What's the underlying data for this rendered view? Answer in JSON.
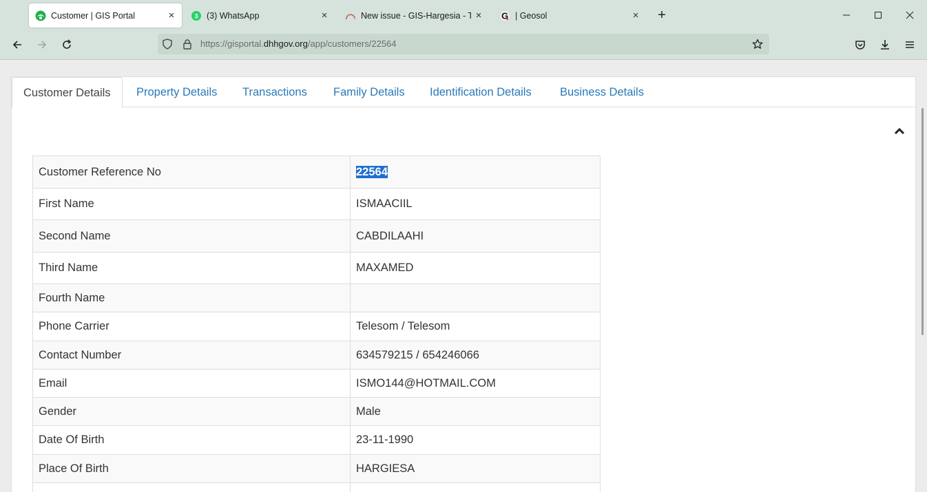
{
  "browser": {
    "tabs": [
      {
        "title": "Customer | GIS Portal",
        "icon": "gis-portal-icon",
        "close": "×"
      },
      {
        "title": "(3) WhatsApp",
        "icon": "whatsapp-icon",
        "badge": "3",
        "close": "×"
      },
      {
        "title": "New issue - GIS-Hargesia - Tean",
        "icon": "gitlab-icon",
        "close": "×"
      },
      {
        "title": "| Geosol",
        "icon": "geosol-icon",
        "badge": "G",
        "close": "×"
      }
    ],
    "new_tab": "+",
    "url": {
      "prefix": "https://gisportal.",
      "domain": "dhhgov.org",
      "path": "/app/customers/22564"
    }
  },
  "page": {
    "tabs": [
      {
        "label": "Customer Details",
        "active": true
      },
      {
        "label": "Property Details"
      },
      {
        "label": "Transactions"
      },
      {
        "label": "Family Details"
      },
      {
        "label": "Identification Details"
      },
      {
        "label": "Business Details"
      }
    ],
    "details": [
      {
        "key": "Customer Reference No",
        "value": "22564"
      },
      {
        "key": "First Name",
        "value": "ISMAACIIL"
      },
      {
        "key": "Second Name",
        "value": "CABDILAAHI"
      },
      {
        "key": "Third Name",
        "value": "MAXAMED"
      },
      {
        "key": "Fourth Name",
        "value": ""
      },
      {
        "key": "Phone Carrier",
        "value": "Telesom / Telesom"
      },
      {
        "key": "Contact Number",
        "value": "634579215 / 654246066"
      },
      {
        "key": "Email",
        "value": "ISMO144@HOTMAIL.COM"
      },
      {
        "key": "Gender",
        "value": "Male"
      },
      {
        "key": "Date Of Birth",
        "value": "23-11-1990"
      },
      {
        "key": "Place Of Birth",
        "value": "HARGIESA"
      }
    ]
  },
  "colors": {
    "chrome": "#d6e3dc",
    "link": "#2a7ab8",
    "selection": "#1e6fd1",
    "whatsapp": "#25d366",
    "gitlab": "#c0392b"
  }
}
